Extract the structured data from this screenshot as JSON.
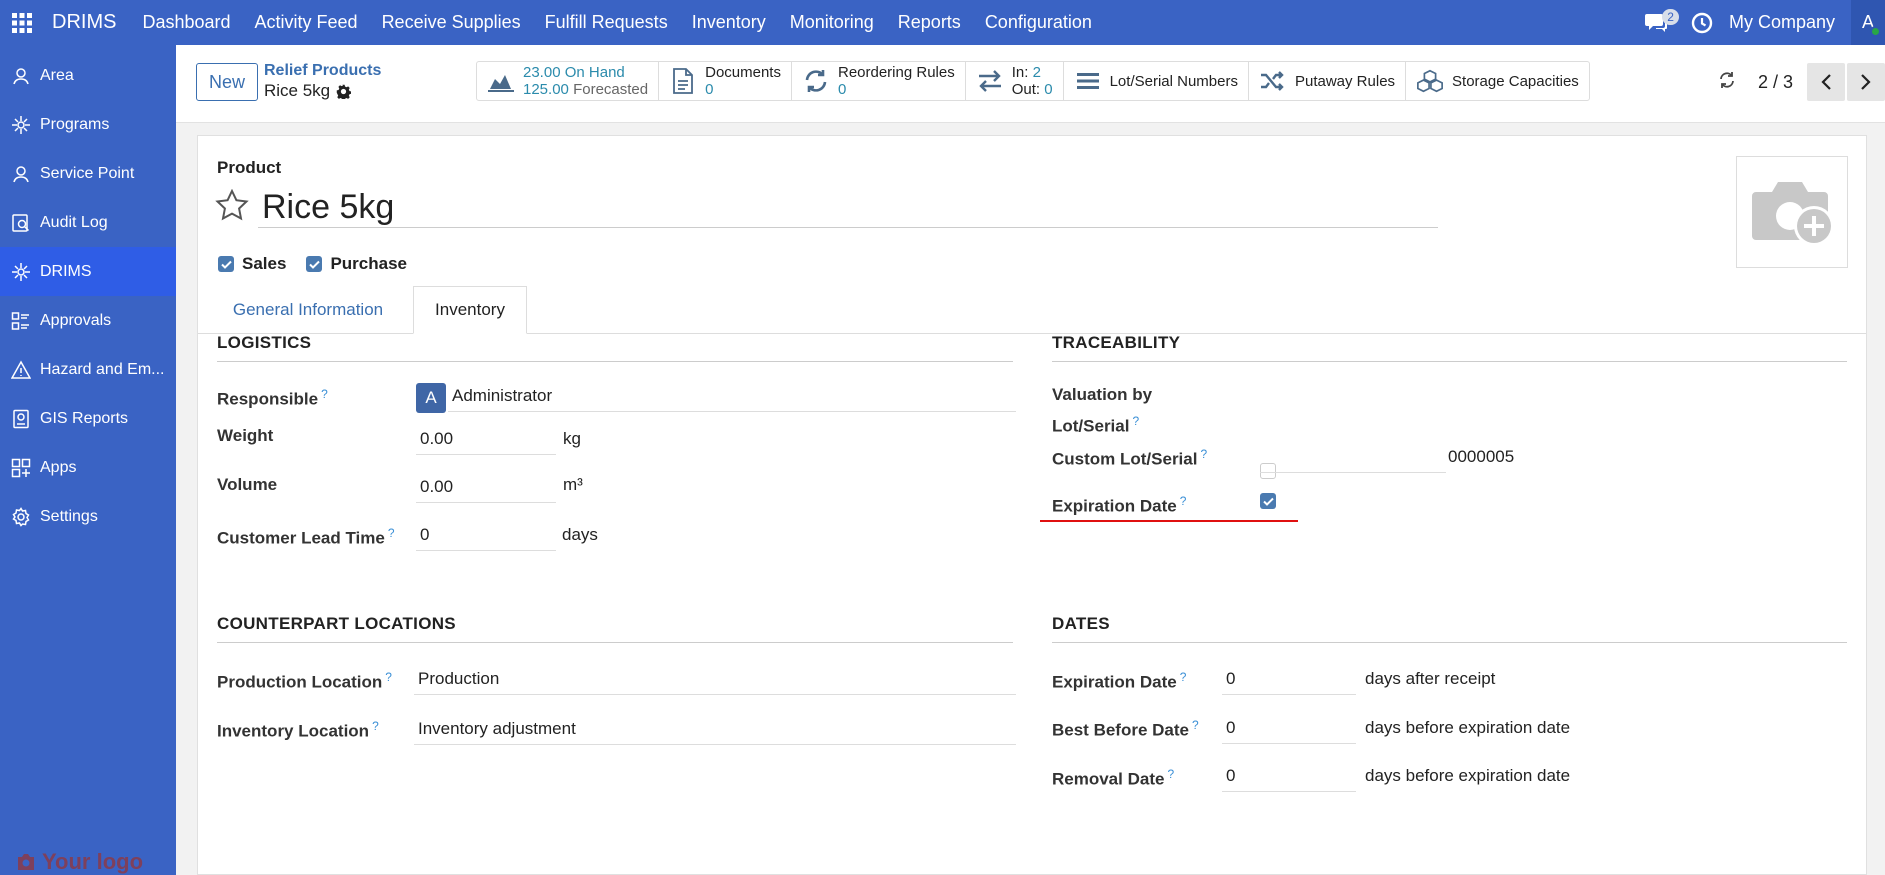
{
  "app": {
    "brand": "DRIMS"
  },
  "topmenu": [
    "Dashboard",
    "Activity Feed",
    "Receive Supplies",
    "Fulfill Requests",
    "Inventory",
    "Monitoring",
    "Reports",
    "Configuration"
  ],
  "topright": {
    "chat_badge": "2",
    "company": "My Company",
    "user_initial": "A"
  },
  "sidebar": {
    "items": [
      {
        "label": "Area",
        "icon": "area-icon"
      },
      {
        "label": "Programs",
        "icon": "programs-icon"
      },
      {
        "label": "Service Point",
        "icon": "service-point-icon"
      },
      {
        "label": "Audit Log",
        "icon": "audit-log-icon"
      },
      {
        "label": "DRIMS",
        "icon": "drims-icon",
        "active": true
      },
      {
        "label": "Approvals",
        "icon": "approvals-icon"
      },
      {
        "label": "Hazard and Em...",
        "icon": "hazard-icon"
      },
      {
        "label": "GIS Reports",
        "icon": "gis-icon"
      },
      {
        "label": "Apps",
        "icon": "apps-icon"
      },
      {
        "label": "Settings",
        "icon": "settings-icon"
      }
    ],
    "logo": "Your logo"
  },
  "control": {
    "new_label": "New",
    "breadcrumb_parent": "Relief Products",
    "breadcrumb_current": "Rice 5kg",
    "stats": {
      "on_hand_value": "23.00",
      "on_hand_label": "On Hand",
      "forecast_value": "125.00",
      "forecast_label": "Forecasted",
      "documents_label": "Documents",
      "documents_count": "0",
      "reorder_label": "Reordering Rules",
      "reorder_count": "0",
      "in_label": "In:",
      "in_count": "2",
      "out_label": "Out:",
      "out_count": "0",
      "lot_label": "Lot/Serial Numbers",
      "putaway_label": "Putaway Rules",
      "storage_label": "Storage Capacities"
    },
    "pager": "2 / 3"
  },
  "form": {
    "product_label": "Product",
    "name": "Rice 5kg",
    "sales_label": "Sales",
    "purchase_label": "Purchase",
    "tabs": [
      "General Information",
      "Inventory"
    ],
    "logistics": {
      "title": "LOGISTICS",
      "responsible_label": "Responsible",
      "responsible_initial": "A",
      "responsible_value": "Administrator",
      "weight_label": "Weight",
      "weight_value": "0.00",
      "weight_unit": "kg",
      "volume_label": "Volume",
      "volume_value": "0.00",
      "volume_unit": "m³",
      "lead_label": "Customer Lead Time",
      "lead_value": "0",
      "lead_unit": "days"
    },
    "traceability": {
      "title": "TRACEABILITY",
      "valuation_label_1": "Valuation by",
      "valuation_label_2": "Lot/Serial",
      "custom_lot_label": "Custom Lot/Serial",
      "custom_lot_value": "0000005",
      "expiration_label": "Expiration Date"
    },
    "counterpart": {
      "title": "COUNTERPART LOCATIONS",
      "production_label": "Production Location",
      "production_value": "Production",
      "inventory_label": "Inventory Location",
      "inventory_value": "Inventory adjustment"
    },
    "dates": {
      "title": "DATES",
      "exp_label": "Expiration Date",
      "exp_value": "0",
      "exp_unit": "days after receipt",
      "bbd_label": "Best Before Date",
      "bbd_value": "0",
      "bbd_unit": "days before expiration date",
      "removal_label": "Removal Date",
      "removal_value": "0",
      "removal_unit": "days before expiration date"
    }
  },
  "colors": {
    "nav": "#3a63c4",
    "active": "#2f5de6",
    "accent": "#3a6fb0",
    "highlight": "#e01010"
  }
}
